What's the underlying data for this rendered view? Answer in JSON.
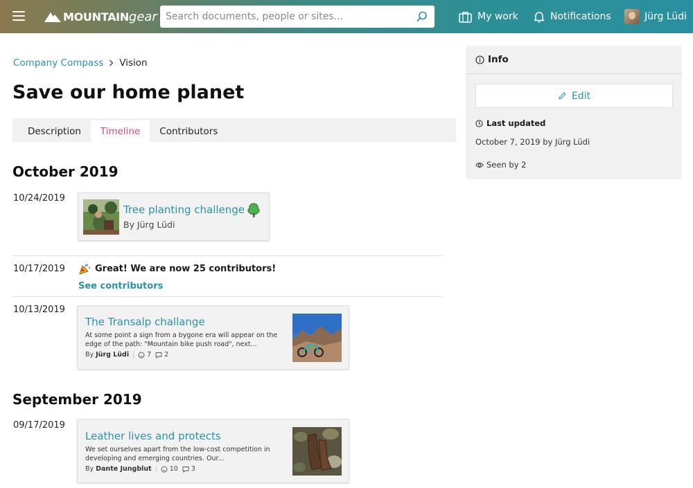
{
  "header": {
    "logo_bold": "MOUNTAIN",
    "logo_light": "gear",
    "search_placeholder": "Search documents, people or sites...",
    "my_work": "My work",
    "notifications": "Notifications",
    "user_name": "Jürg Lüdi"
  },
  "breadcrumb": {
    "parent": "Company Compass",
    "current": "Vision"
  },
  "page": {
    "title": "Save our home planet"
  },
  "tabs": [
    "Description",
    "Timeline",
    "Contributors"
  ],
  "timeline": {
    "months": [
      "October 2019",
      "September 2019"
    ],
    "entries": [
      {
        "date": "10/24/2019",
        "title": "Tree planting challenge",
        "byline": "By Jürg Lüdi"
      },
      {
        "date": "10/17/2019",
        "milestone": "Great! We are now 25 contributors!",
        "link": "See contributors"
      },
      {
        "date": "10/13/2019",
        "title": "The Transalp challange",
        "excerpt": "At some point a sign from a bygone era will appear on the edge of the path: \"Mountain bike push road\", next...",
        "author_prefix": "By",
        "author": "Jürg Lüdi",
        "likes": "7",
        "comments": "2"
      },
      {
        "date": "09/17/2019",
        "title": "Leather lives and protects",
        "excerpt": "We set ourselves apart from the low-cost competition in developing and emerging countries. Our...",
        "author_prefix": "By",
        "author": "Dante Jungblut",
        "likes": "10",
        "comments": "3"
      }
    ]
  },
  "info": {
    "heading": "Info",
    "edit": "Edit",
    "last_updated_label": "Last updated",
    "last_updated_value": "October 7, 2019 by Jürg Lüdi",
    "seen_by": "Seen by 2"
  },
  "colors": {
    "accent": "#2a93a8",
    "tab_active": "#e0467c"
  }
}
